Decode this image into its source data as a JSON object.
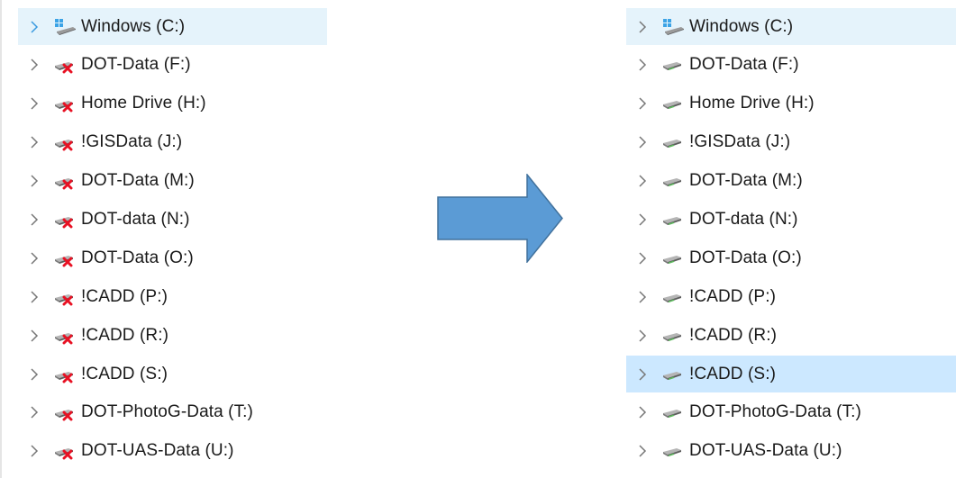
{
  "before": {
    "items": [
      {
        "label": "Windows  (C:)",
        "icon": "windows-drive-icon",
        "state": "selected"
      },
      {
        "label": "DOT-Data (F:)",
        "icon": "disconnected-network-drive-icon",
        "state": ""
      },
      {
        "label": "Home Drive (H:)",
        "icon": "disconnected-network-drive-icon",
        "state": ""
      },
      {
        "label": "!GISData (J:)",
        "icon": "disconnected-network-drive-icon",
        "state": ""
      },
      {
        "label": "DOT-Data (M:)",
        "icon": "disconnected-network-drive-icon",
        "state": ""
      },
      {
        "label": "DOT-data (N:)",
        "icon": "disconnected-network-drive-icon",
        "state": ""
      },
      {
        "label": "DOT-Data (O:)",
        "icon": "disconnected-network-drive-icon",
        "state": ""
      },
      {
        "label": "!CADD (P:)",
        "icon": "disconnected-network-drive-icon",
        "state": ""
      },
      {
        "label": "!CADD (R:)",
        "icon": "disconnected-network-drive-icon",
        "state": ""
      },
      {
        "label": "!CADD (S:)",
        "icon": "disconnected-network-drive-icon",
        "state": ""
      },
      {
        "label": "DOT-PhotoG-Data (T:)",
        "icon": "disconnected-network-drive-icon",
        "state": ""
      },
      {
        "label": "DOT-UAS-Data (U:)",
        "icon": "disconnected-network-drive-icon",
        "state": ""
      }
    ]
  },
  "after": {
    "items": [
      {
        "label": "Windows  (C:)",
        "icon": "windows-drive-icon",
        "state": "selected"
      },
      {
        "label": "DOT-Data (F:)",
        "icon": "network-drive-icon",
        "state": ""
      },
      {
        "label": "Home Drive (H:)",
        "icon": "network-drive-icon",
        "state": ""
      },
      {
        "label": "!GISData (J:)",
        "icon": "network-drive-icon",
        "state": ""
      },
      {
        "label": "DOT-Data (M:)",
        "icon": "network-drive-icon",
        "state": ""
      },
      {
        "label": "DOT-data (N:)",
        "icon": "network-drive-icon",
        "state": ""
      },
      {
        "label": "DOT-Data (O:)",
        "icon": "network-drive-icon",
        "state": ""
      },
      {
        "label": "!CADD (P:)",
        "icon": "network-drive-icon",
        "state": ""
      },
      {
        "label": "!CADD (R:)",
        "icon": "network-drive-icon",
        "state": ""
      },
      {
        "label": "!CADD (S:)",
        "icon": "network-drive-icon",
        "state": "focused"
      },
      {
        "label": "DOT-PhotoG-Data (T:)",
        "icon": "network-drive-icon",
        "state": ""
      },
      {
        "label": "DOT-UAS-Data (U:)",
        "icon": "network-drive-icon",
        "state": ""
      }
    ]
  },
  "arrow": {
    "icon": "right-arrow-icon",
    "fill": "#5b9bd5",
    "stroke": "#41719c"
  },
  "colors": {
    "selected_row": "#e5f3fb",
    "focused_row": "#cce8ff",
    "chevron": "#777777",
    "chevron_active": "#3a9ae0",
    "disconnect_x": "#e81123",
    "connected_green": "#5cb85c"
  }
}
